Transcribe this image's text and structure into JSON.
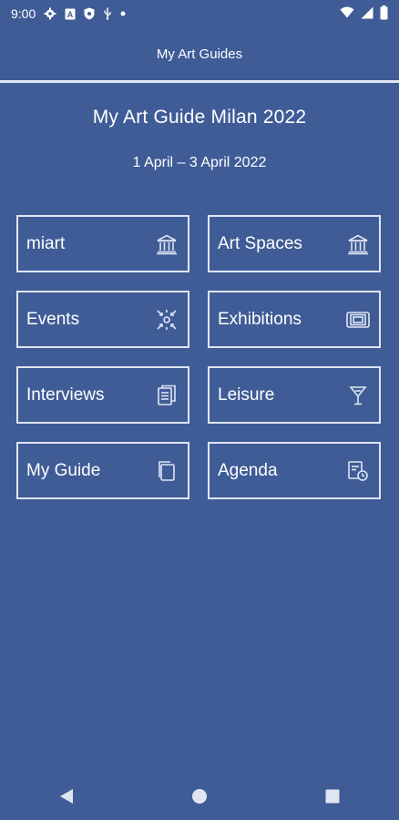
{
  "status_bar": {
    "time": "9:00",
    "icons_left": [
      "settings-icon",
      "a-icon",
      "shield-icon",
      "usb-icon",
      "dot-icon"
    ],
    "icons_right": [
      "wifi-icon",
      "signal-icon",
      "battery-icon"
    ]
  },
  "app_bar": {
    "title": "My Art Guides"
  },
  "guide": {
    "title": "My Art Guide Milan 2022",
    "dates": "1 April – 3 April 2022"
  },
  "tiles": [
    {
      "label": "miart",
      "icon": "museum-icon"
    },
    {
      "label": "Art Spaces",
      "icon": "museum-icon"
    },
    {
      "label": "Events",
      "icon": "sparkle-arrows-icon"
    },
    {
      "label": "Exhibitions",
      "icon": "frames-icon"
    },
    {
      "label": "Interviews",
      "icon": "document-icon"
    },
    {
      "label": "Leisure",
      "icon": "cocktail-icon"
    },
    {
      "label": "My Guide",
      "icon": "copy-icon"
    },
    {
      "label": "Agenda",
      "icon": "calendar-clock-icon"
    }
  ],
  "colors": {
    "background": "#3f5c97",
    "line": "#dfe6f2",
    "text": "#ffffff"
  },
  "nav_bar": {
    "buttons": [
      "back-icon",
      "home-icon",
      "recents-icon"
    ]
  }
}
